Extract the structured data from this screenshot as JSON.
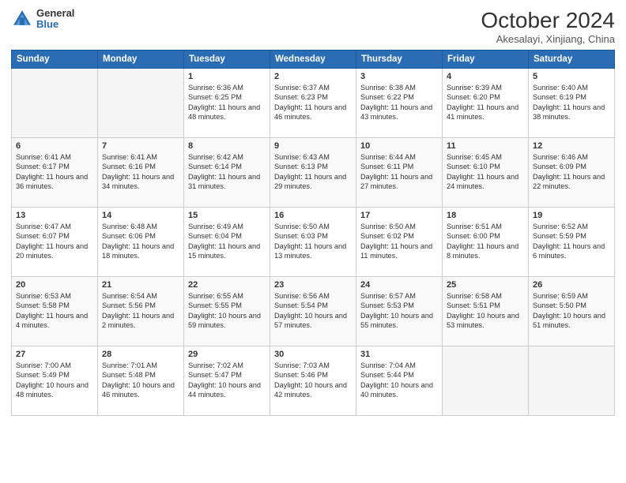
{
  "logo": {
    "general": "General",
    "blue": "Blue"
  },
  "title": {
    "month": "October 2024",
    "location": "Akesalayi, Xinjiang, China"
  },
  "headers": [
    "Sunday",
    "Monday",
    "Tuesday",
    "Wednesday",
    "Thursday",
    "Friday",
    "Saturday"
  ],
  "weeks": [
    [
      {
        "day": "",
        "info": ""
      },
      {
        "day": "",
        "info": ""
      },
      {
        "day": "1",
        "info": "Sunrise: 6:36 AM\nSunset: 6:25 PM\nDaylight: 11 hours and 48 minutes."
      },
      {
        "day": "2",
        "info": "Sunrise: 6:37 AM\nSunset: 6:23 PM\nDaylight: 11 hours and 46 minutes."
      },
      {
        "day": "3",
        "info": "Sunrise: 6:38 AM\nSunset: 6:22 PM\nDaylight: 11 hours and 43 minutes."
      },
      {
        "day": "4",
        "info": "Sunrise: 6:39 AM\nSunset: 6:20 PM\nDaylight: 11 hours and 41 minutes."
      },
      {
        "day": "5",
        "info": "Sunrise: 6:40 AM\nSunset: 6:19 PM\nDaylight: 11 hours and 38 minutes."
      }
    ],
    [
      {
        "day": "6",
        "info": "Sunrise: 6:41 AM\nSunset: 6:17 PM\nDaylight: 11 hours and 36 minutes."
      },
      {
        "day": "7",
        "info": "Sunrise: 6:41 AM\nSunset: 6:16 PM\nDaylight: 11 hours and 34 minutes."
      },
      {
        "day": "8",
        "info": "Sunrise: 6:42 AM\nSunset: 6:14 PM\nDaylight: 11 hours and 31 minutes."
      },
      {
        "day": "9",
        "info": "Sunrise: 6:43 AM\nSunset: 6:13 PM\nDaylight: 11 hours and 29 minutes."
      },
      {
        "day": "10",
        "info": "Sunrise: 6:44 AM\nSunset: 6:11 PM\nDaylight: 11 hours and 27 minutes."
      },
      {
        "day": "11",
        "info": "Sunrise: 6:45 AM\nSunset: 6:10 PM\nDaylight: 11 hours and 24 minutes."
      },
      {
        "day": "12",
        "info": "Sunrise: 6:46 AM\nSunset: 6:09 PM\nDaylight: 11 hours and 22 minutes."
      }
    ],
    [
      {
        "day": "13",
        "info": "Sunrise: 6:47 AM\nSunset: 6:07 PM\nDaylight: 11 hours and 20 minutes."
      },
      {
        "day": "14",
        "info": "Sunrise: 6:48 AM\nSunset: 6:06 PM\nDaylight: 11 hours and 18 minutes."
      },
      {
        "day": "15",
        "info": "Sunrise: 6:49 AM\nSunset: 6:04 PM\nDaylight: 11 hours and 15 minutes."
      },
      {
        "day": "16",
        "info": "Sunrise: 6:50 AM\nSunset: 6:03 PM\nDaylight: 11 hours and 13 minutes."
      },
      {
        "day": "17",
        "info": "Sunrise: 6:50 AM\nSunset: 6:02 PM\nDaylight: 11 hours and 11 minutes."
      },
      {
        "day": "18",
        "info": "Sunrise: 6:51 AM\nSunset: 6:00 PM\nDaylight: 11 hours and 8 minutes."
      },
      {
        "day": "19",
        "info": "Sunrise: 6:52 AM\nSunset: 5:59 PM\nDaylight: 11 hours and 6 minutes."
      }
    ],
    [
      {
        "day": "20",
        "info": "Sunrise: 6:53 AM\nSunset: 5:58 PM\nDaylight: 11 hours and 4 minutes."
      },
      {
        "day": "21",
        "info": "Sunrise: 6:54 AM\nSunset: 5:56 PM\nDaylight: 11 hours and 2 minutes."
      },
      {
        "day": "22",
        "info": "Sunrise: 6:55 AM\nSunset: 5:55 PM\nDaylight: 10 hours and 59 minutes."
      },
      {
        "day": "23",
        "info": "Sunrise: 6:56 AM\nSunset: 5:54 PM\nDaylight: 10 hours and 57 minutes."
      },
      {
        "day": "24",
        "info": "Sunrise: 6:57 AM\nSunset: 5:53 PM\nDaylight: 10 hours and 55 minutes."
      },
      {
        "day": "25",
        "info": "Sunrise: 6:58 AM\nSunset: 5:51 PM\nDaylight: 10 hours and 53 minutes."
      },
      {
        "day": "26",
        "info": "Sunrise: 6:59 AM\nSunset: 5:50 PM\nDaylight: 10 hours and 51 minutes."
      }
    ],
    [
      {
        "day": "27",
        "info": "Sunrise: 7:00 AM\nSunset: 5:49 PM\nDaylight: 10 hours and 48 minutes."
      },
      {
        "day": "28",
        "info": "Sunrise: 7:01 AM\nSunset: 5:48 PM\nDaylight: 10 hours and 46 minutes."
      },
      {
        "day": "29",
        "info": "Sunrise: 7:02 AM\nSunset: 5:47 PM\nDaylight: 10 hours and 44 minutes."
      },
      {
        "day": "30",
        "info": "Sunrise: 7:03 AM\nSunset: 5:46 PM\nDaylight: 10 hours and 42 minutes."
      },
      {
        "day": "31",
        "info": "Sunrise: 7:04 AM\nSunset: 5:44 PM\nDaylight: 10 hours and 40 minutes."
      },
      {
        "day": "",
        "info": ""
      },
      {
        "day": "",
        "info": ""
      }
    ]
  ]
}
